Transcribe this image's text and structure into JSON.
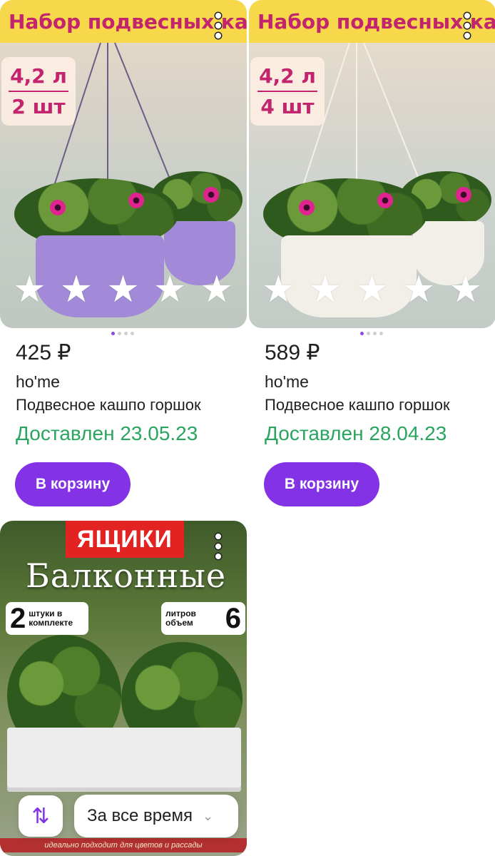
{
  "products": [
    {
      "image_banner": "Набор подвесных кашпо",
      "image_spec_volume": "4,2 л",
      "image_spec_count": "2 шт",
      "pot_color": "#a28ad8",
      "price": "425 ₽",
      "brand": "ho'me",
      "title": "Подвесное кашпо горшок",
      "delivery": "Доставлен 23.05.23",
      "cart_label": "В корзину",
      "rating_stars": 5
    },
    {
      "image_banner": "Набор подвесных кашпо",
      "image_spec_volume": "4,2 л",
      "image_spec_count": "4 шт",
      "pot_color": "#f2efe8",
      "price": "589 ₽",
      "brand": "ho'me",
      "title": "Подвесное кашпо горшок",
      "delivery": "Доставлен 28.04.23",
      "cart_label": "В корзину",
      "rating_stars": 5
    },
    {
      "image_banner": "ЯЩИКИ",
      "image_headline": "Балконные",
      "badge_left_number": "2",
      "badge_left_text": "штуки в комплекте",
      "badge_right_text": "литров объем",
      "badge_right_number": "6",
      "image_footer": "идеально подходит для цветов и рассады"
    }
  ],
  "controls": {
    "sort_icon": "sort-arrows-icon",
    "period_label": "За все время",
    "period_chevron": "chevron-down-icon"
  },
  "colors": {
    "accent": "#8432e6",
    "delivered": "#2aa55f",
    "banner_yellow": "#f7d84b",
    "banner_text": "#c2246e"
  }
}
